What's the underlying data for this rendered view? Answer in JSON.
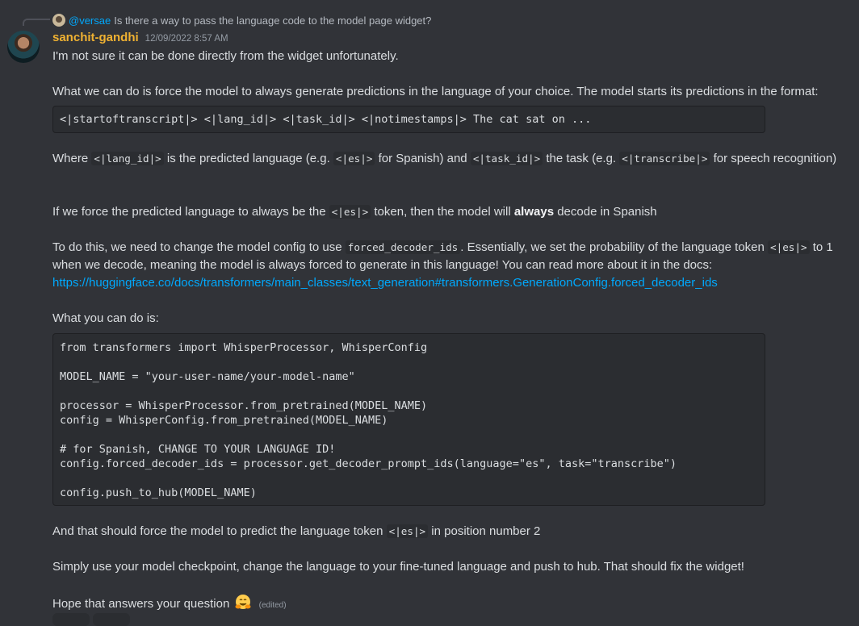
{
  "reply": {
    "username": "@versae",
    "text": "Is there a way to pass the language code to the model page widget?"
  },
  "message": {
    "username": "sanchit-gandhi",
    "timestamp": "12/09/2022 8:57 AM",
    "p1": "I'm not sure it can be done directly from the widget unfortunately.",
    "p2": "What we can do is force the model to always generate predictions in the language of your choice. The model starts its predictions in the format:",
    "code1": "<|startoftranscript|> <|lang_id|> <|task_id|> <|notimestamps|> The cat sat on ...",
    "p3": {
      "t1": "Where ",
      "c1": "<|lang_id|>",
      "t2": " is the predicted language (e.g. ",
      "c2": "<|es|>",
      "t3": " for Spanish) and ",
      "c3": "<|task_id|>",
      "t4": " the task (e.g. ",
      "c4": "<|transcribe|>",
      "t5": " for speech recognition)"
    },
    "p4": {
      "t1": "If we force the predicted language to always be the ",
      "c1": "<|es|>",
      "t2": " token, then the model will ",
      "bold": "always",
      "t3": " decode in Spanish"
    },
    "p5": {
      "t1": "To do this, we need to change the model config to use ",
      "c1": "forced_decoder_ids",
      "t2": ". Essentially, we set the probability of the language token ",
      "c2": "<|es|>",
      "t3": " to 1 when we decode, meaning the model is always forced to generate in this language! You can read more about it in the docs:",
      "link": "https://huggingface.co/docs/transformers/main_classes/text_generation#transformers.GenerationConfig.forced_decoder_ids"
    },
    "p6": "What you can do is:",
    "code2": "from transformers import WhisperProcessor, WhisperConfig\n\nMODEL_NAME = \"your-user-name/your-model-name\"\n\nprocessor = WhisperProcessor.from_pretrained(MODEL_NAME)\nconfig = WhisperConfig.from_pretrained(MODEL_NAME)\n\n# for Spanish, CHANGE TO YOUR LANGUAGE ID!\nconfig.forced_decoder_ids = processor.get_decoder_prompt_ids(language=\"es\", task=\"transcribe\")\n\nconfig.push_to_hub(MODEL_NAME)",
    "p7": {
      "t1": "And that should force the model to predict the language token ",
      "c1": "<|es|>",
      "t2": " in position number 2"
    },
    "p8": "Simply use your model checkpoint, change the language to your fine-tuned language and push to hub. That should fix the widget!",
    "p9": "Hope that answers your question",
    "emoji": "hugging-face-emoji",
    "edited": "(edited)"
  },
  "colors": {
    "background": "#313338",
    "username": "#f0b232",
    "link": "#00a8fc",
    "code_bg": "#2b2d31"
  }
}
